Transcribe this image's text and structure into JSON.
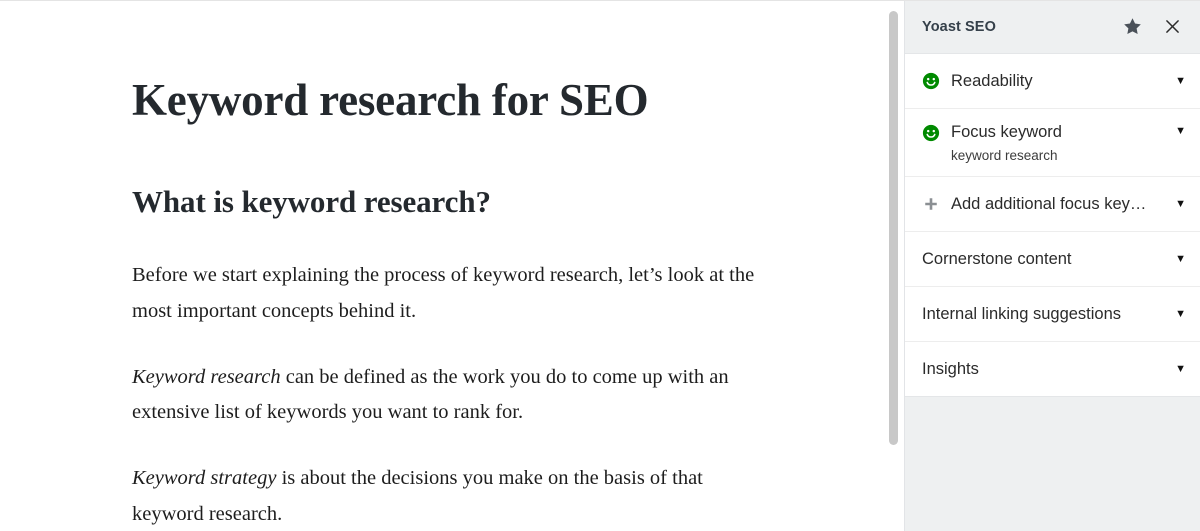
{
  "document": {
    "title": "Keyword research for SEO",
    "subtitle": "What is keyword research?",
    "paragraph_1": "Before we start explaining the process of keyword research, let’s look at the most important concepts behind it.",
    "paragraph_2_em": "Keyword research",
    "paragraph_2_rest": " can be defined as the work you do to come up with an extensive list of keywords you want to rank for.",
    "paragraph_3_em": "Keyword strategy",
    "paragraph_3_rest": " is about the decisions you make on the basis of that keyword research."
  },
  "sidebar": {
    "title": "Yoast SEO",
    "star_icon": "star-icon",
    "close_icon": "close-icon",
    "rows": [
      {
        "label": "Readability",
        "sublabel": "",
        "bullet": "green-smiley-icon",
        "chevron": "▼"
      },
      {
        "label": "Focus keyword",
        "sublabel": "keyword research",
        "bullet": "green-smiley-icon",
        "chevron": "▼"
      },
      {
        "label": "Add additional focus key…",
        "sublabel": "",
        "bullet": "plus-icon",
        "chevron": "▼"
      },
      {
        "label": "Cornerstone content",
        "sublabel": "",
        "bullet": "none",
        "chevron": "▼"
      },
      {
        "label": "Internal linking suggestions",
        "sublabel": "",
        "bullet": "none",
        "chevron": "▼"
      },
      {
        "label": "Insights",
        "sublabel": "",
        "bullet": "none",
        "chevron": "▼"
      }
    ]
  },
  "colors": {
    "score_good": "#008a00",
    "panel_bg": "#eef0f1",
    "star": "#4a5159",
    "accent_text": "#2b2b2b"
  },
  "scrollbar": {
    "orientation": "vertical",
    "thumb_color": "#c8c8c8"
  }
}
